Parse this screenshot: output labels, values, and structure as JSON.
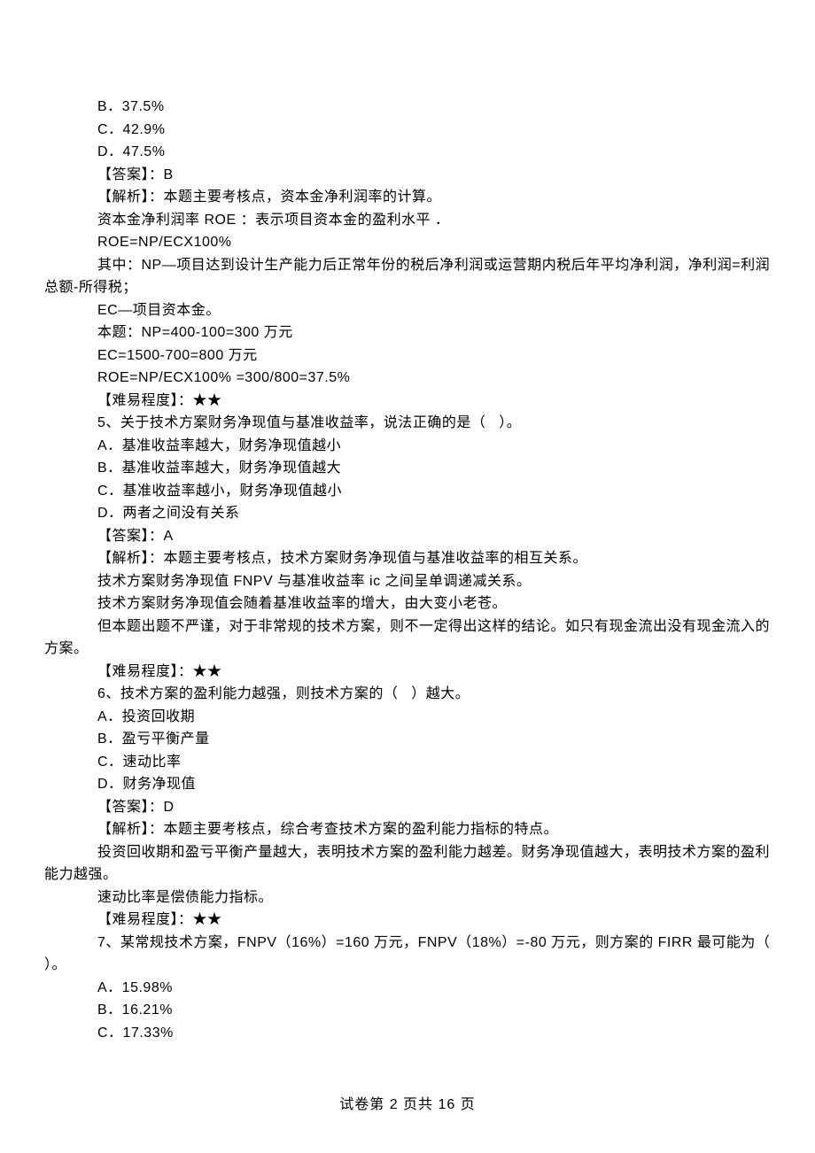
{
  "lines": [
    "B．37.5%",
    "C．42.9%",
    "D．47.5%",
    "【答案】：B",
    "【解析】：本题主要考核点，资本金净利润率的计算。",
    "资本金净利润率 ROE ：表示项目资本金的盈利水平 ．",
    "ROE=NP/ECX100%",
    "其中：NP—项目达到设计生产能力后正常年份的税后净利润或运营期内税后年平均净利润，净利润=利润总额-所得税；",
    "EC—项目资本金。",
    "本题：NP=400-100=300 万元",
    "EC=1500-700=800 万元",
    "ROE=NP/ECX100% =300/800=37.5%",
    "【难易程度】：★★",
    "5、关于技术方案财务净现值与基准收益率，说法正确的是（   ）。",
    "A．基准收益率越大，财务净现值越小",
    "B．基准收益率越大，财务净现值越大",
    "C．基准收益率越小，财务净现值越小",
    "D．两者之间没有关系",
    "【答案】：A",
    "【解析】：本题主要考核点，技术方案财务净现值与基准收益率的相互关系。",
    "技术方案财务净现值 FNPV 与基准收益率 ic 之间呈单调递减关系。",
    "技术方案财务净现值会随着基准收益率的增大，由大变小老苍。",
    "但本题出题不严谨，对于非常规的技术方案，则不一定得出这样的结论。如只有现金流出没有现金流入的方案。",
    "【难易程度】：★★",
    "6、技术方案的盈利能力越强，则技术方案的（   ）越大。",
    "A．投资回收期",
    "B．盈亏平衡产量",
    "C．速动比率",
    "D．财务净现值",
    "【答案】：D",
    "【解析】：本题主要考核点，综合考查技术方案的盈利能力指标的特点。",
    "投资回收期和盈亏平衡产量越大，表明技术方案的盈利能力越差。财务净现值越大，表明技术方案的盈利能力越强。",
    "速动比率是偿债能力指标。",
    "【难易程度】：★★",
    "7、某常规技术方案，FNPV（16%）=160 万元，FNPV（18%）=-80 万元，则方案的 FIRR 最可能为（   ）。",
    "A．15.98%",
    "B．16.21%",
    "C．17.33%"
  ],
  "wrapIndexes": [
    7,
    22,
    31,
    34
  ],
  "footer": "试卷第 2 页共 16 页"
}
